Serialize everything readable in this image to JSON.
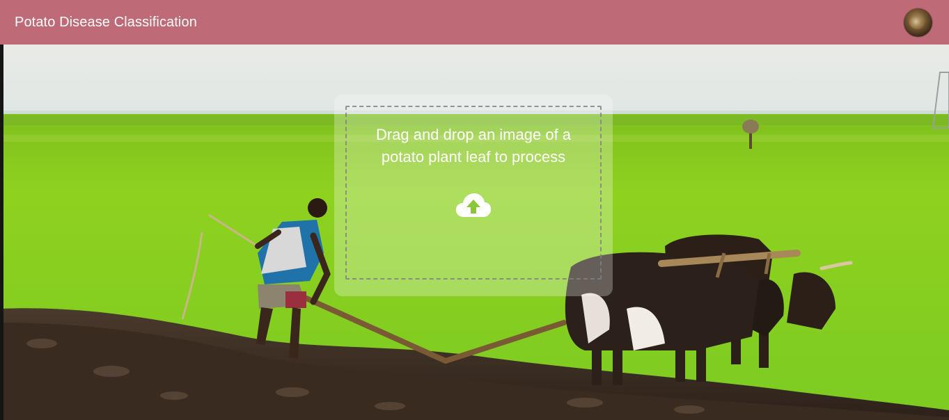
{
  "header": {
    "title": "Potato Disease Classification",
    "bar_color": "#be6a77"
  },
  "background": {
    "scene": "farmer plowing a green field with two oxen",
    "icon": "background-photo"
  },
  "dropzone": {
    "message": "Drag and drop an image of a potato plant leaf to process",
    "icon": "cloud-upload-icon"
  },
  "avatar": {
    "icon": "user-avatar"
  }
}
